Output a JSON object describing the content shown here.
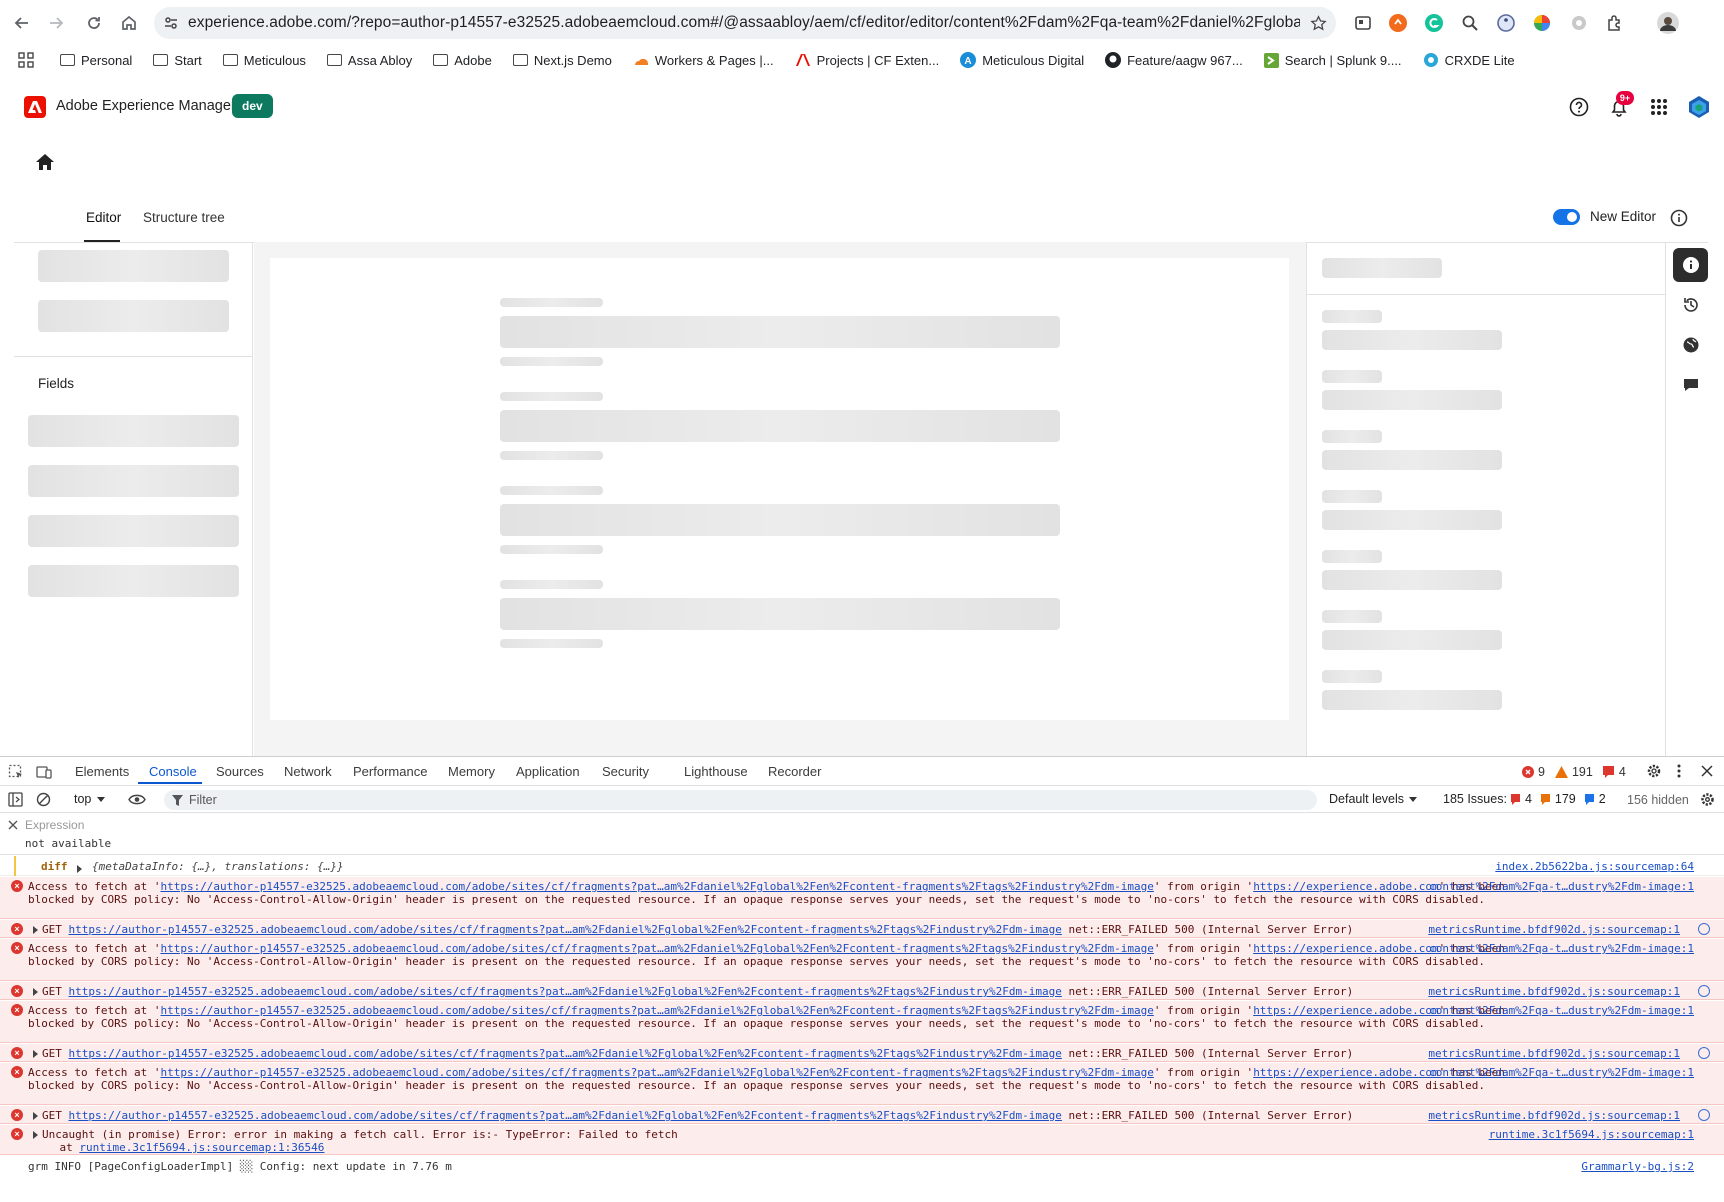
{
  "browser": {
    "url": "experience.adobe.com/?repo=author-p14557-e32525.adobeaemcloud.com#/@assaabloy/aem/cf/editor/editor/content%2Fdam%2Fqa-team%2Fdaniel%2Fglobal%2...",
    "bookmarks": [
      {
        "label": "Personal",
        "icon": "folder-icon"
      },
      {
        "label": "Start",
        "icon": "folder-icon"
      },
      {
        "label": "Meticulous",
        "icon": "folder-icon"
      },
      {
        "label": "Assa Abloy",
        "icon": "folder-icon"
      },
      {
        "label": "Adobe",
        "icon": "folder-icon"
      },
      {
        "label": "Next.js Demo",
        "icon": "folder-icon"
      },
      {
        "label": "Workers & Pages |...",
        "icon": "cloudflare-icon"
      },
      {
        "label": "Projects | CF Exten...",
        "icon": "adobe-icon"
      },
      {
        "label": "Meticulous Digital",
        "icon": "meticulous-icon"
      },
      {
        "label": "Feature/aagw 967...",
        "icon": "github-icon"
      },
      {
        "label": "Search | Splunk 9....",
        "icon": "splunk-icon"
      },
      {
        "label": "CRXDE Lite",
        "icon": "crxde-icon"
      }
    ]
  },
  "aem": {
    "product_name": "Adobe Experience Manager",
    "env_badge": "dev",
    "notifications_badge": "9+",
    "tabs": {
      "editor": "Editor",
      "structure_tree": "Structure tree"
    },
    "new_editor_label": "New Editor",
    "new_editor_enabled": true,
    "fields_heading": "Fields"
  },
  "devtools": {
    "tabs": [
      "Elements",
      "Console",
      "Sources",
      "Network",
      "Performance",
      "Memory",
      "Application",
      "Security",
      "Lighthouse",
      "Recorder"
    ],
    "active_tab": "Console",
    "counts": {
      "errors": "9",
      "warnings": "191",
      "issues": "4"
    },
    "context": "top",
    "filter_placeholder": "Filter",
    "levels": "Default levels",
    "issues_label": "185 Issues:",
    "issues_counts": {
      "errors": "4",
      "warnings": "179",
      "info": "2"
    },
    "hidden": "156 hidden",
    "expression_label": "Expression",
    "expression_value": "not available",
    "diff_line": {
      "label": "diff",
      "value": "{metaDataInfo: {…}, translations: {…}}",
      "source": "index.2b5622ba.js:sourcemap:64"
    },
    "cors": {
      "pre": "Access to fetch at '",
      "url": "https://author-p14557-e32525.adobeaemcloud.com/adobe/sites/cf/fragments?pat…am%2Fdaniel%2Fglobal%2Fen%2Fcontent-fragments%2Ftags%2Findustry%2Fdm-image",
      "mid": "' from origin '",
      "origin": "https://experience.adobe.com",
      "post": "' has been blocked by CORS policy: No 'Access-Control-Allow-Origin' header is present on the requested resource. If an opaque response serves your needs, set the request's mode to 'no-cors' to fetch the resource with CORS disabled.",
      "source": "content%2Fdam%2Fqa-t…dustry%2Fdm-image:1"
    },
    "get": {
      "pre": "GET ",
      "url": "https://author-p14557-e32525.adobeaemcloud.com/adobe/sites/cf/fragments?pat…am%2Fdaniel%2Fglobal%2Fen%2Fcontent-fragments%2Ftags%2Findustry%2Fdm-image",
      "post": " net::ERR_FAILED 500 (Internal Server Error)",
      "source": "metricsRuntime.bfdf902d.js:sourcemap:1"
    },
    "uncaught": {
      "text": "Uncaught (in promise) Error: error in making a fetch call. Error is:- TypeError: Failed to fetch",
      "at": "    at ",
      "at_link": "runtime.3c1f5694.js:sourcemap:1:36546",
      "source": "runtime.3c1f5694.js:sourcemap:1"
    },
    "info_line": {
      "text": "grm INFO [PageConfigLoaderImpl] ░░ Config: next update in 7.76 m",
      "source": "Grammarly-bg.js:2"
    }
  },
  "colors": {
    "adobe_red": "#eb1000",
    "env_badge": "#0d7a5f",
    "toggle_blue": "#1473e6",
    "error_bg": "#fdecec",
    "link": "#1a4fc4",
    "devtools_active": "#0b57d0"
  }
}
